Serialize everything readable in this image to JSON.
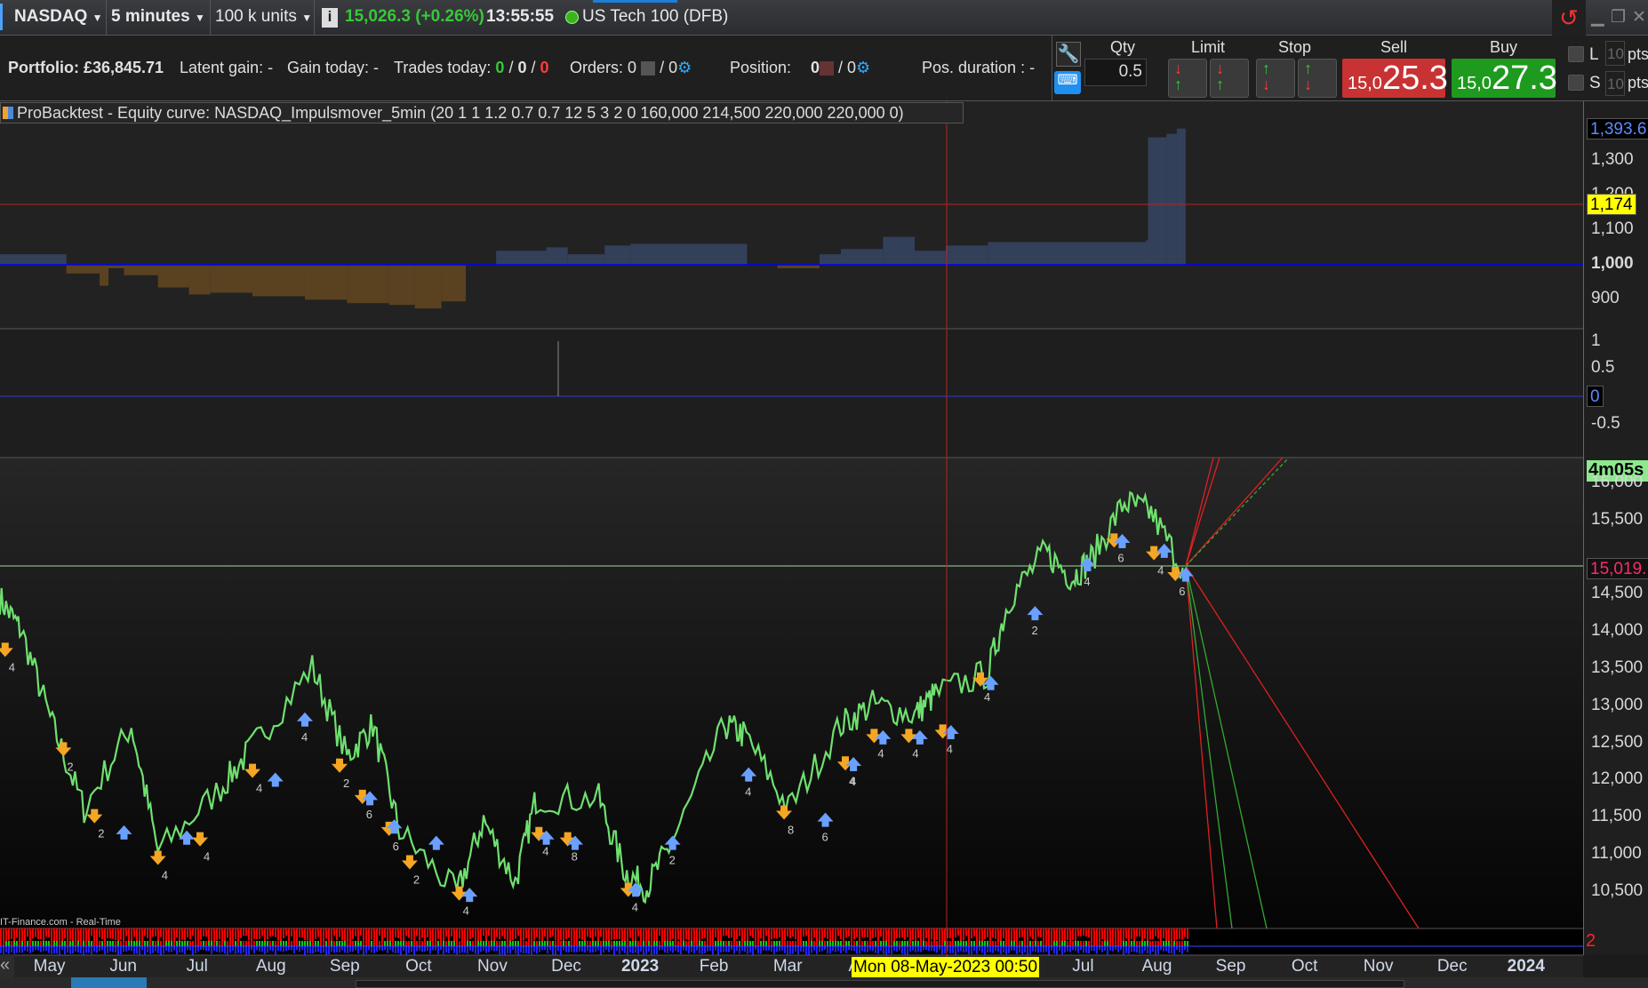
{
  "topbar": {
    "instrument": "NASDAQ",
    "timeframe": "5 minutes",
    "size": "100 k units",
    "price": "15,026.3 (+0.26%)",
    "time": "13:55:55",
    "market": "US Tech 100 (DFB)"
  },
  "account": {
    "portfolio": "Portfolio: £36,845.71",
    "latent": "Latent gain: -",
    "gain_today": "Gain today: -",
    "trades_label": "Trades today:",
    "trades_win": "0",
    "trades_even": "0",
    "trades_loss": "0",
    "slash": "/",
    "orders_label": "Orders: 0",
    "orders_pending": "/ 0",
    "position_label": "Position:",
    "position_val": "0",
    "position_pending": "/ 0",
    "pos_duration": "Pos. duration : -"
  },
  "order_panel": {
    "qty_label": "Qty",
    "qty_value": "0.5",
    "limit_label": "Limit",
    "stop_label": "Stop",
    "sell_label": "Sell",
    "sell_prefix": "15,0",
    "sell_big": "25.3",
    "buy_label": "Buy",
    "buy_prefix": "15,0",
    "buy_big": "27.3",
    "long_label": "L",
    "short_label": "S",
    "long_pts": "10",
    "short_pts": "10",
    "pts": "pts"
  },
  "equity_panel": {
    "title": "ProBacktest - Equity curve: NASDAQ_Impulsmover_5min (20 1 1 1.2 0.7 0.7 12 5 3 2 0 160,000 214,500 220,000 220,000 0)",
    "last_value": "1,393.6",
    "cursor_value": "1,174",
    "ticks": [
      "1,300",
      "1,200",
      "1,100",
      "1,000",
      "900"
    ]
  },
  "indicator_panel": {
    "ticks": [
      "1",
      "0.5",
      "0",
      "-0.5"
    ]
  },
  "price_panel": {
    "countdown": "4m05s",
    "last_price": "15,019.",
    "ticks": [
      "16,000",
      "15,500",
      "15,000",
      "14,500",
      "14,000",
      "13,500",
      "13,000",
      "12,500",
      "12,000",
      "11,500",
      "11,000",
      "10,500"
    ],
    "source": "IT-Finance.com - Real-Time"
  },
  "volume_panel": {
    "label": "2"
  },
  "date_axis": {
    "months": [
      "May",
      "Jun",
      "Jul",
      "Aug",
      "Sep",
      "Oct",
      "Nov",
      "Dec",
      "2023",
      "Feb",
      "Mar",
      "Apr",
      "",
      "",
      "Jul",
      "Aug",
      "Sep",
      "Oct",
      "Nov",
      "Dec",
      "2024"
    ],
    "cursor_date": "Mon 08-May-2023 00:50",
    "scroll_left": "«"
  },
  "colors": {
    "price_line": "#6fe06f",
    "sell_arrow": "#f5a623",
    "buy_arrow": "#6aa0ff",
    "equity_line": "#f0a030",
    "sell_box": "#c83232",
    "buy_box": "#1e9a1e"
  },
  "chart_data": {
    "type": "line",
    "x_unit": "months since May 2022",
    "price_series": [
      [
        -0.67,
        14586
      ],
      [
        -0.38,
        14160
      ],
      [
        0.04,
        12890
      ],
      [
        0.47,
        11760
      ],
      [
        1.11,
        12890
      ],
      [
        1.47,
        11190
      ],
      [
        2.32,
        12040
      ],
      [
        2.75,
        12600
      ],
      [
        3.56,
        13670
      ],
      [
        4.03,
        12460
      ],
      [
        4.38,
        12890
      ],
      [
        4.74,
        11470
      ],
      [
        5.52,
        10620
      ],
      [
        5.88,
        11610
      ],
      [
        6.31,
        10770
      ],
      [
        6.59,
        11900
      ],
      [
        7.44,
        11900
      ],
      [
        7.8,
        10910
      ],
      [
        8.09,
        10700
      ],
      [
        8.44,
        11330
      ],
      [
        9.15,
        12890
      ],
      [
        9.44,
        12740
      ],
      [
        10.01,
        11760
      ],
      [
        10.72,
        12890
      ],
      [
        11.15,
        13170
      ],
      [
        11.72,
        13030
      ],
      [
        12.0,
        13310
      ],
      [
        12.71,
        13590
      ],
      [
        13.0,
        14590
      ],
      [
        13.49,
        15220
      ],
      [
        13.85,
        14870
      ],
      [
        14.13,
        15150
      ],
      [
        14.56,
        15890
      ],
      [
        14.92,
        15750
      ],
      [
        15.35,
        15010
      ]
    ],
    "price_ylim": [
      10300,
      16500
    ],
    "equity_steps": [
      [
        -0.67,
        1030
      ],
      [
        0.23,
        975
      ],
      [
        0.68,
        940
      ],
      [
        0.8,
        990
      ],
      [
        1.01,
        970
      ],
      [
        1.47,
        935
      ],
      [
        1.89,
        915
      ],
      [
        2.18,
        920
      ],
      [
        2.75,
        910
      ],
      [
        3.46,
        900
      ],
      [
        4.03,
        890
      ],
      [
        4.6,
        885
      ],
      [
        4.95,
        875
      ],
      [
        5.31,
        895
      ],
      [
        5.64,
        1000
      ],
      [
        6.05,
        1040
      ],
      [
        6.73,
        1050
      ],
      [
        7.02,
        1030
      ],
      [
        7.52,
        1055
      ],
      [
        7.87,
        1060
      ],
      [
        9.45,
        1000
      ],
      [
        9.86,
        990
      ],
      [
        10.43,
        1030
      ],
      [
        10.72,
        1045
      ],
      [
        11.29,
        1080
      ],
      [
        11.72,
        1040
      ],
      [
        12.14,
        1055
      ],
      [
        12.71,
        1065
      ],
      [
        14.85,
        1070
      ],
      [
        14.88,
        1365
      ],
      [
        15.13,
        1375
      ],
      [
        15.27,
        1390
      ],
      [
        15.39,
        1393.6
      ]
    ],
    "equity_baseline": 1000,
    "sell_signals": [
      [
        -0.6,
        13880,
        "4"
      ],
      [
        0.19,
        12540,
        "2"
      ],
      [
        0.61,
        11640,
        "2"
      ],
      [
        1.47,
        11080,
        "4"
      ],
      [
        2.04,
        11330,
        "4"
      ],
      [
        2.75,
        12250,
        "4"
      ],
      [
        3.93,
        12320,
        "2"
      ],
      [
        4.24,
        11900,
        "6"
      ],
      [
        4.6,
        11470,
        "6"
      ],
      [
        4.88,
        11020,
        "2"
      ],
      [
        5.55,
        10600,
        "4"
      ],
      [
        6.63,
        11400,
        "4"
      ],
      [
        7.02,
        11330,
        "8"
      ],
      [
        7.84,
        10650,
        "4"
      ],
      [
        9.95,
        11690,
        "8"
      ],
      [
        10.78,
        12350,
        "4"
      ],
      [
        11.17,
        12720,
        "4"
      ],
      [
        11.64,
        12720,
        "4"
      ],
      [
        12.1,
        12780,
        "4"
      ],
      [
        12.61,
        13480,
        "4"
      ],
      [
        14.42,
        15350,
        "6"
      ],
      [
        14.96,
        15180,
        "4"
      ],
      [
        15.25,
        14900,
        "6"
      ]
    ],
    "buy_signals": [
      [
        1.01,
        11470,
        ""
      ],
      [
        1.86,
        11400,
        ""
      ],
      [
        3.06,
        12180,
        ""
      ],
      [
        3.46,
        12990,
        "4"
      ],
      [
        4.34,
        11930,
        ""
      ],
      [
        4.67,
        11550,
        ""
      ],
      [
        5.24,
        11330,
        ""
      ],
      [
        5.69,
        10630,
        ""
      ],
      [
        6.73,
        11400,
        ""
      ],
      [
        7.12,
        11330,
        ""
      ],
      [
        7.94,
        10700,
        ""
      ],
      [
        8.44,
        11330,
        "2"
      ],
      [
        9.47,
        12250,
        "4"
      ],
      [
        10.51,
        11640,
        "6"
      ],
      [
        10.89,
        12390,
        "4"
      ],
      [
        11.29,
        12750,
        ""
      ],
      [
        11.79,
        12750,
        ""
      ],
      [
        12.21,
        12820,
        ""
      ],
      [
        12.75,
        13480,
        ""
      ],
      [
        13.35,
        14420,
        "2"
      ],
      [
        14.06,
        15080,
        "4"
      ],
      [
        14.53,
        15390,
        ""
      ],
      [
        15.1,
        15260,
        ""
      ],
      [
        15.39,
        14940,
        ""
      ]
    ]
  }
}
